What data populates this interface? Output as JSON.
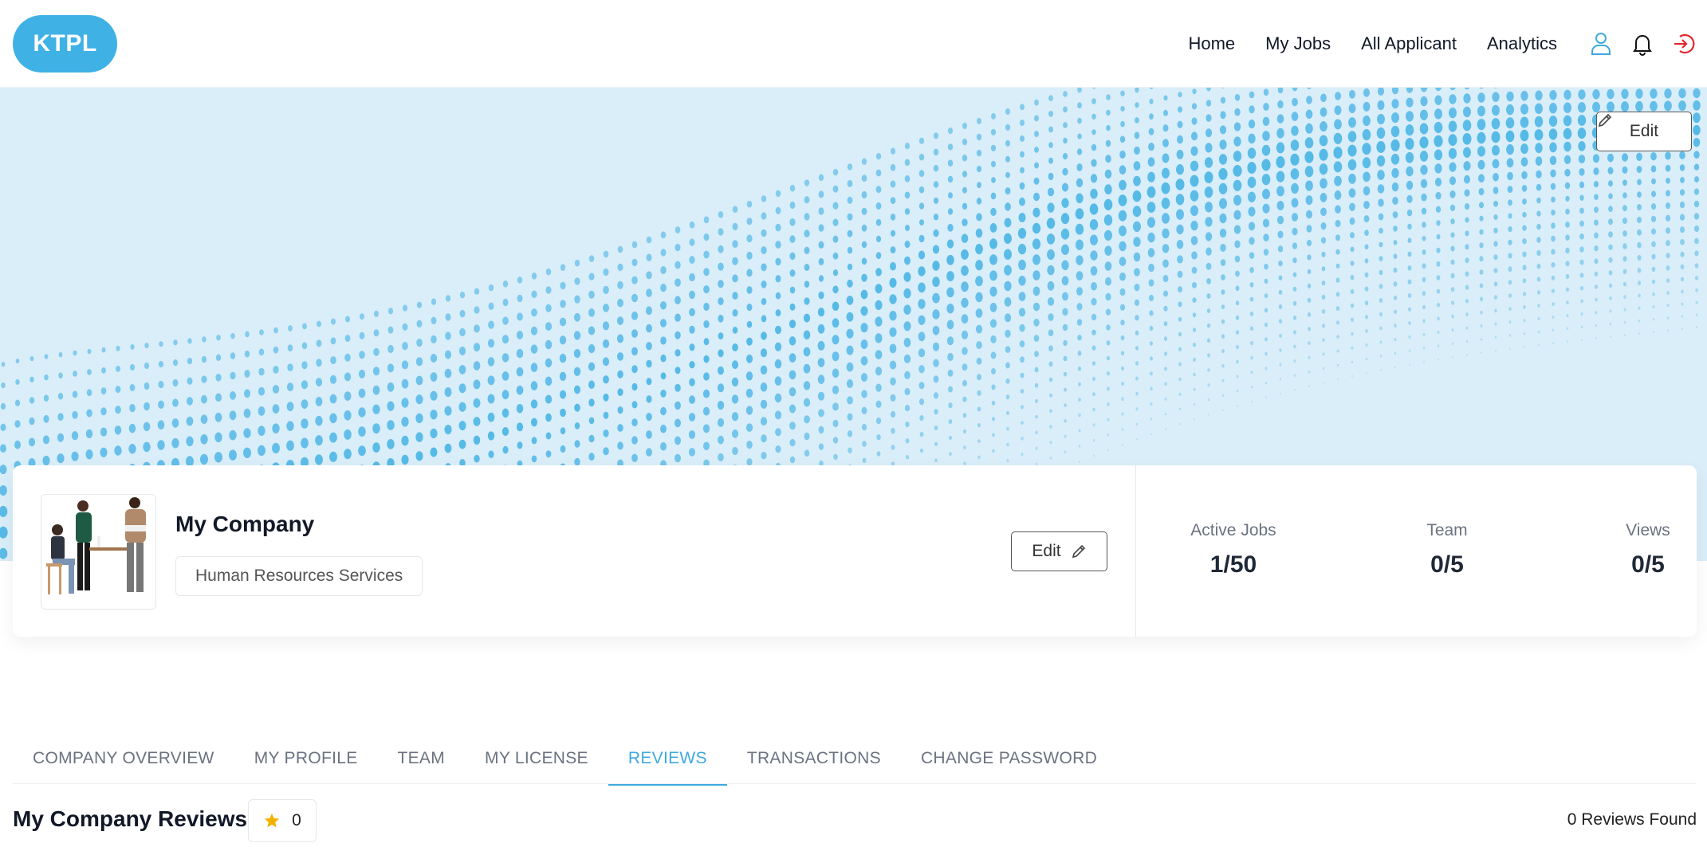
{
  "brand": {
    "logo_text": "KTPL",
    "accent": "#3fb1e5"
  },
  "nav": {
    "items": [
      "Home",
      "My Jobs",
      "All Applicant",
      "Analytics"
    ],
    "icons": [
      "user-icon",
      "bell-icon",
      "logout-icon"
    ]
  },
  "banner": {
    "edit_label": "Edit"
  },
  "profile": {
    "company_name": "My Company",
    "industry": "Human Resources Services",
    "edit_label": "Edit",
    "stats": [
      {
        "label": "Active Jobs",
        "value": "1/50"
      },
      {
        "label": "Team",
        "value": "0/5"
      },
      {
        "label": "Views",
        "value": "0/5"
      }
    ]
  },
  "tabs": {
    "items": [
      "COMPANY OVERVIEW",
      "MY PROFILE",
      "TEAM",
      "MY LICENSE",
      "REVIEWS",
      "TRANSACTIONS",
      "CHANGE PASSWORD"
    ],
    "active": "REVIEWS"
  },
  "reviews": {
    "title": "My Company Reviews",
    "rating": "0",
    "count_text": "0 Reviews Found"
  }
}
